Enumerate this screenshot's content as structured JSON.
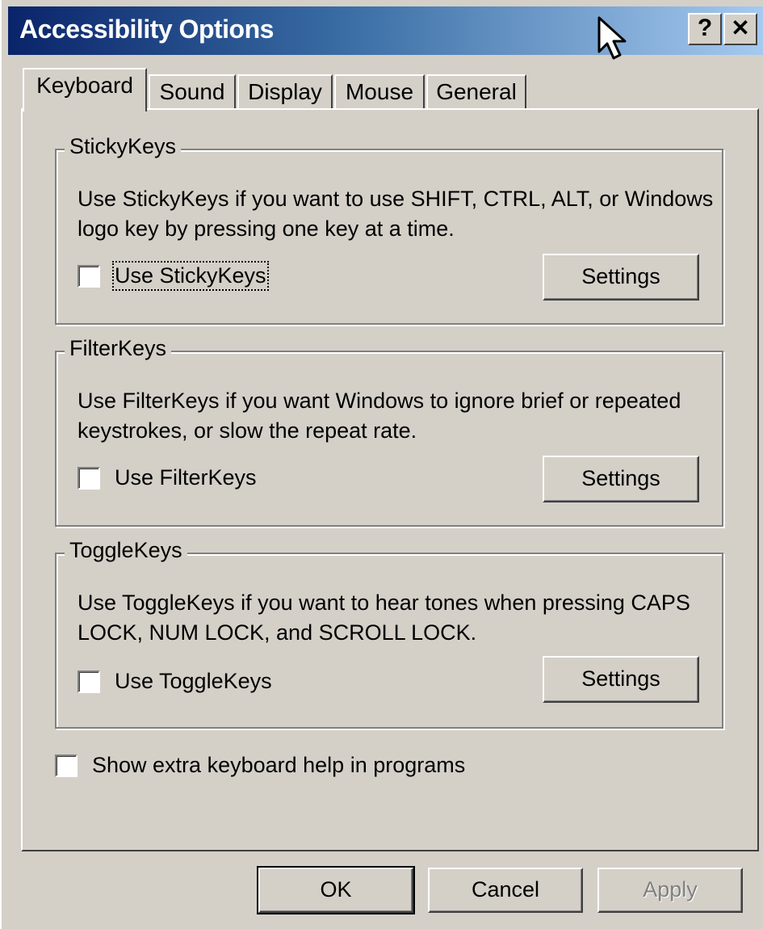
{
  "window": {
    "title": "Accessibility Options",
    "help_glyph": "?",
    "close_glyph": "✕"
  },
  "tabs": [
    {
      "label": "Keyboard",
      "active": true
    },
    {
      "label": "Sound",
      "active": false
    },
    {
      "label": "Display",
      "active": false
    },
    {
      "label": "Mouse",
      "active": false
    },
    {
      "label": "General",
      "active": false
    }
  ],
  "groups": {
    "stickykeys": {
      "title": "StickyKeys",
      "description": "Use StickyKeys if you want to use SHIFT, CTRL, ALT, or Windows logo key by pressing one key at a time.",
      "checkbox_label": "Use StickyKeys",
      "checked": false,
      "settings_label": "Settings"
    },
    "filterkeys": {
      "title": "FilterKeys",
      "description": "Use FilterKeys if you want Windows to ignore brief or repeated keystrokes, or slow the repeat rate.",
      "checkbox_label": "Use FilterKeys",
      "checked": false,
      "settings_label": "Settings"
    },
    "togglekeys": {
      "title": "ToggleKeys",
      "description": "Use ToggleKeys if you want to hear tones when pressing CAPS LOCK, NUM LOCK, and SCROLL LOCK.",
      "checkbox_label": "Use ToggleKeys",
      "checked": false,
      "settings_label": "Settings"
    }
  },
  "extra_help": {
    "label": "Show extra keyboard help in programs",
    "checked": false
  },
  "footer": {
    "ok_label": "OK",
    "cancel_label": "Cancel",
    "apply_label": "Apply",
    "apply_enabled": false
  },
  "colors": {
    "title_start": "#0a246a",
    "title_end": "#a6caf0",
    "face": "#d4d0c8"
  }
}
